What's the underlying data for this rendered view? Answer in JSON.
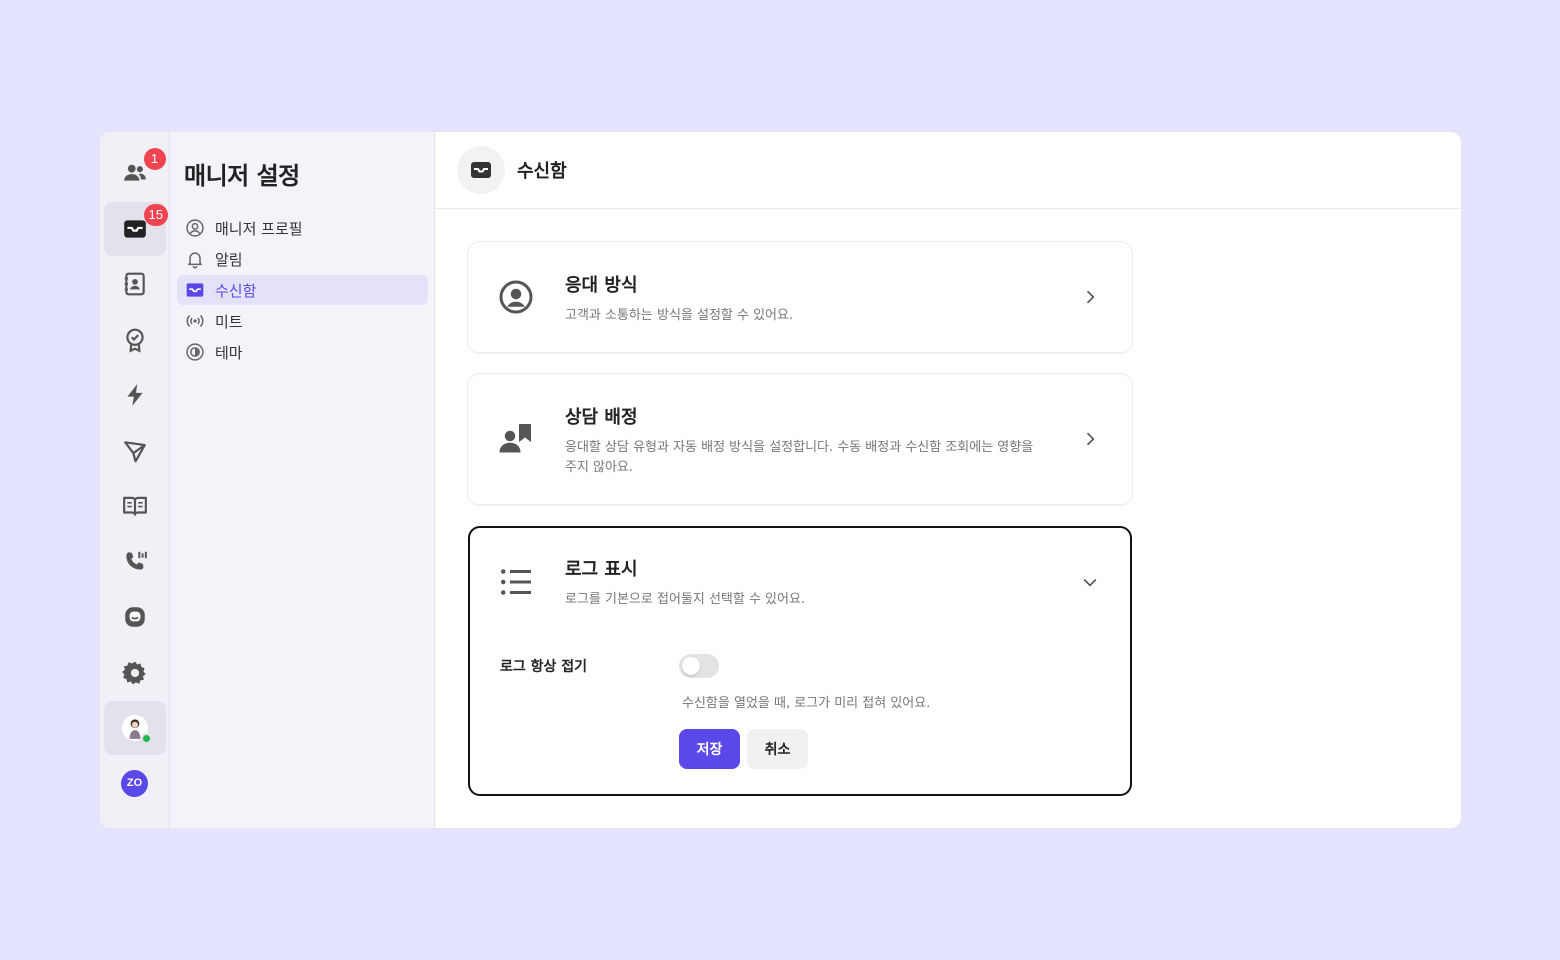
{
  "rail": {
    "contacts_badge": "1",
    "inbox_badge": "15"
  },
  "menu": {
    "title": "매니저 설정",
    "items": [
      {
        "label": "매니저 프로필",
        "icon": "user-circle-icon"
      },
      {
        "label": "알림",
        "icon": "bell-icon"
      },
      {
        "label": "수신함",
        "icon": "inbox-icon"
      },
      {
        "label": "미트",
        "icon": "broadcast-icon"
      },
      {
        "label": "테마",
        "icon": "theme-icon"
      }
    ]
  },
  "header": {
    "title": "수신함",
    "icon": "inbox-icon"
  },
  "cards": [
    {
      "title": "응대 방식",
      "desc": "고객과 소통하는 방식을 설정할 수 있어요.",
      "icon": "user-circle-icon"
    },
    {
      "title": "상담 배정",
      "desc": "응대할 상담 유형과 자동 배정 방식을 설정합니다. 수동 배정과 수신함 조회에는 영향을 주지 않아요.",
      "icon": "assign-icon"
    },
    {
      "title": "로그 표시",
      "desc": "로그를 기본으로 접어둘지 선택할 수 있어요.",
      "icon": "list-icon"
    }
  ],
  "log_settings": {
    "toggle_label": "로그 항상 접기",
    "toggle_on": false,
    "toggle_help": "수신함을 열었을 때, 로그가 미리 접혀 있어요.",
    "save_label": "저장",
    "cancel_label": "취소"
  },
  "colors": {
    "accent": "#5a49e8",
    "badge": "#f04451",
    "background": "#e4e4fe"
  },
  "brand": {
    "logo_text": "ZO"
  }
}
